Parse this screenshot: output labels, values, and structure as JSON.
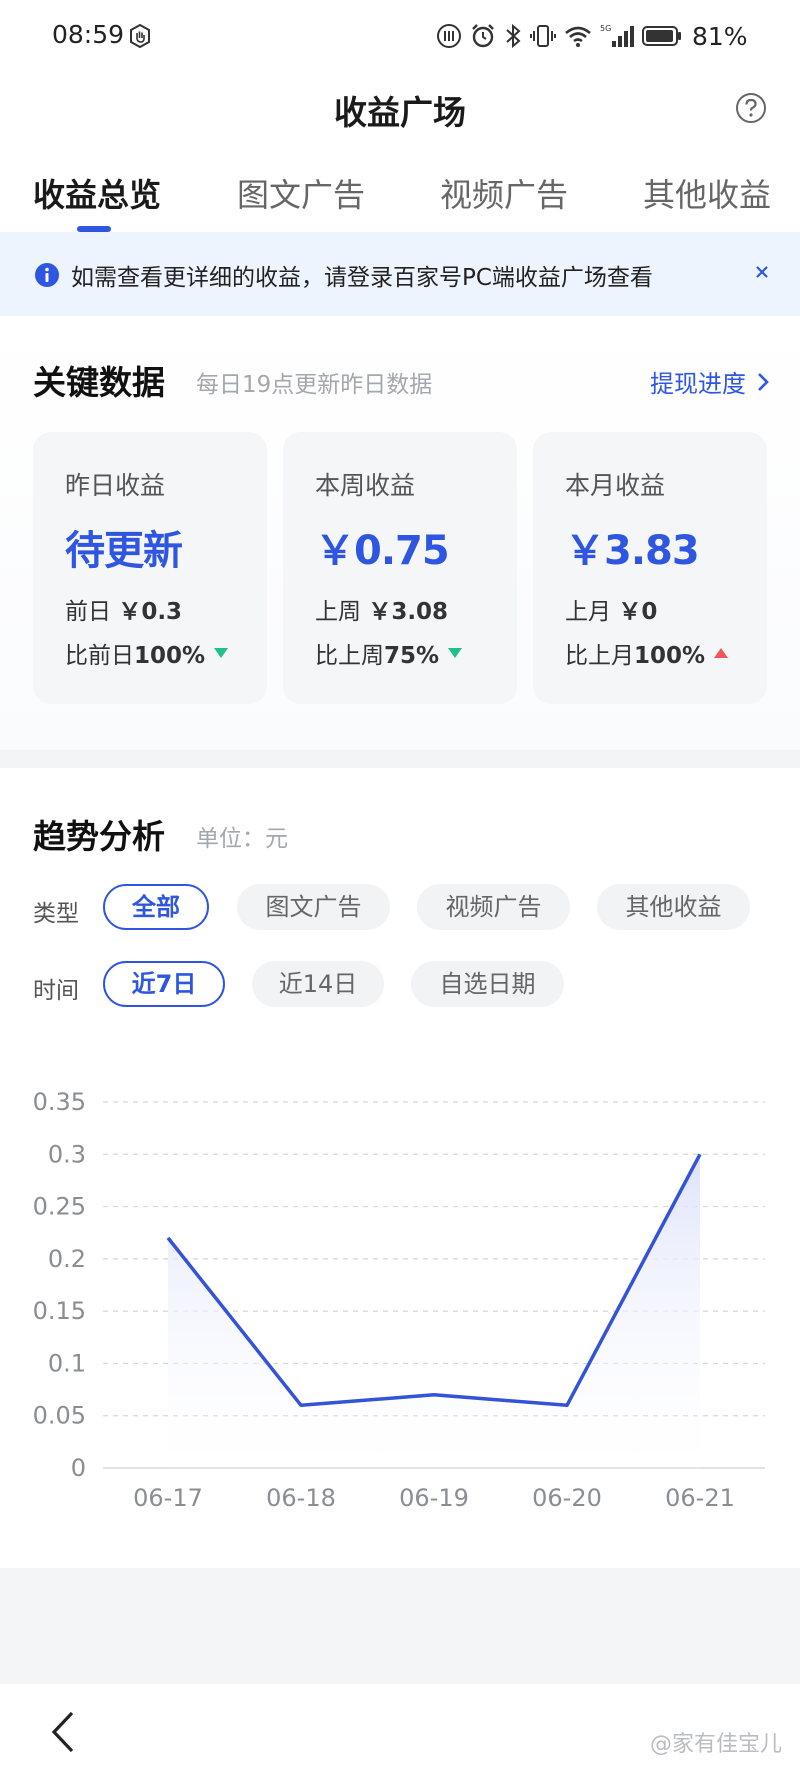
{
  "status_bar": {
    "time": "08:59",
    "battery": "81%",
    "network": "5G"
  },
  "header": {
    "title": "收益广场",
    "help_icon": "question-circle-icon"
  },
  "tabs": [
    {
      "label": "收益总览",
      "active": true
    },
    {
      "label": "图文广告",
      "active": false
    },
    {
      "label": "视频广告",
      "active": false
    },
    {
      "label": "其他收益",
      "active": false
    }
  ],
  "notice": {
    "text": "如需查看更详细的收益，请登录百家号PC端收益广场查看",
    "icon": "info-icon",
    "close_icon": "close-icon"
  },
  "key_data": {
    "title": "关键数据",
    "subtitle": "每日19点更新昨日数据",
    "link": "提现进度",
    "cards": [
      {
        "label": "昨日收益",
        "value": "待更新",
        "prev_label": "前日",
        "prev_value": "￥0.3",
        "compare_label": "比前日",
        "compare_value": "100%",
        "trend": "down"
      },
      {
        "label": "本周收益",
        "value": "￥0.75",
        "prev_label": "上周",
        "prev_value": "￥3.08",
        "compare_label": "比上周",
        "compare_value": "75%",
        "trend": "down"
      },
      {
        "label": "本月收益",
        "value": "￥3.83",
        "prev_label": "上月",
        "prev_value": "￥0",
        "compare_label": "比上月",
        "compare_value": "100%",
        "trend": "up"
      }
    ],
    "colors": {
      "accent": "#2f56e0",
      "down": "#1fbf8f",
      "up": "#f2555a"
    }
  },
  "trend": {
    "title": "趋势分析",
    "unit_label": "单位：元",
    "type_label": "类型",
    "type_options": [
      {
        "label": "全部",
        "active": true
      },
      {
        "label": "图文广告",
        "active": false
      },
      {
        "label": "视频广告",
        "active": false
      },
      {
        "label": "其他收益",
        "active": false
      }
    ],
    "time_label": "时间",
    "time_options": [
      {
        "label": "近7日",
        "active": true
      },
      {
        "label": "近14日",
        "active": false
      },
      {
        "label": "自选日期",
        "active": false
      }
    ]
  },
  "chart_data": {
    "type": "area",
    "x": [
      "06-17",
      "06-18",
      "06-19",
      "06-20",
      "06-21"
    ],
    "values": [
      0.22,
      0.06,
      0.07,
      0.06,
      0.3
    ],
    "y_ticks": [
      "0",
      "0.05",
      "0.1",
      "0.15",
      "0.2",
      "0.25",
      "0.3",
      "0.35"
    ],
    "ylim": [
      0,
      0.35
    ],
    "grid": true,
    "line_color": "#3553d6",
    "fill_color": "#e4e8fb"
  },
  "footer": {
    "back_icon": "back-arrow-icon",
    "watermark": "@家有佳宝儿"
  }
}
